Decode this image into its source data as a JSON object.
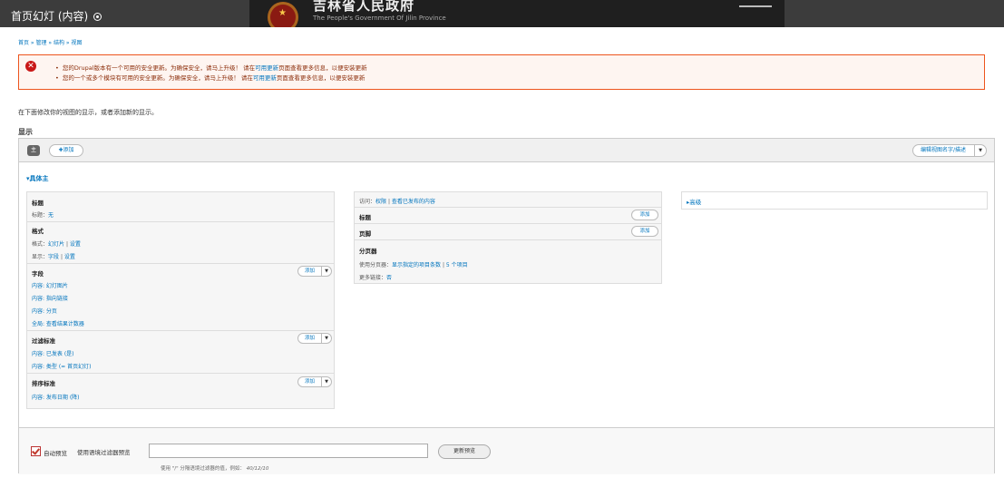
{
  "window": {
    "title": "首页幻灯 (内容)"
  },
  "banner": {
    "cn_text": "吉林省人民政府",
    "en_text": "The People's Government Of Jilin Province"
  },
  "breadcrumb": "首页 » 管理 » 结构 » 视图",
  "messages": [
    {
      "prefix": "您的Drupal版本有一个可用的安全更新。为确保安全，请马上升级！ 请在",
      "link": "可用更新",
      "suffix": "页面查看更多信息，以便安装更新"
    },
    {
      "prefix": "您的一个或多个模块有可用的安全更新。为确保安全，请马上升级！ 请在",
      "link": "可用更新",
      "suffix": "页面查看更多信息，以便安装更新"
    }
  ],
  "intro": "在下面修改你的视图的显示，或者添加新的显示。",
  "section_title": "显示",
  "tabs": {
    "main": "主",
    "add": "✚添加",
    "edit_name": "编辑视图名字/描述"
  },
  "display": {
    "heading": "▾具体主",
    "col1": {
      "title_h": "标题",
      "title_v_label": "标题：",
      "title_v": "无",
      "format_h": "格式",
      "format_label": "格式：",
      "format_link": "幻灯片",
      "format_settings": "设置",
      "show_label": "显示：",
      "show_link": "字段",
      "show_settings": "设置",
      "fields_h": "字段",
      "fields_add": "添加",
      "fields": [
        "内容: 幻灯图片",
        "内容: 指向链接",
        "内容: 分页",
        "全局: 查看结果计数器"
      ],
      "filter_h": "过滤标准",
      "filter_add": "添加",
      "filters": [
        "内容: 已发表 (是)",
        "内容: 类型 (= 首页幻灯)"
      ],
      "sort_h": "排序标准",
      "sort_add": "添加",
      "sorts": [
        "内容: 发布日期 (降)"
      ]
    },
    "col2": {
      "access_label": "访问：",
      "access_link1": "权限",
      "access_link2": "查看已发布的内容",
      "header_h": "标题",
      "header_add": "添加",
      "footer_h": "页脚",
      "footer_add": "添加",
      "pager_h": "分页器",
      "pager_label": "使用分页器：",
      "pager_link1": "显示指定的项目条数",
      "pager_link2": "5 个项目",
      "more_label": "更多链接：",
      "more_link": "否"
    },
    "col3": {
      "advanced": "▸高级"
    }
  },
  "preview": {
    "auto_label": "自动预览",
    "auto_checked": true,
    "context_label": "使用语境过滤器预览",
    "context_value": "",
    "update_button": "更新预览",
    "hint_prefix": "使用 \"/\" 分隔语境过滤器的值，例如：",
    "hint_example": "40/12/10"
  }
}
